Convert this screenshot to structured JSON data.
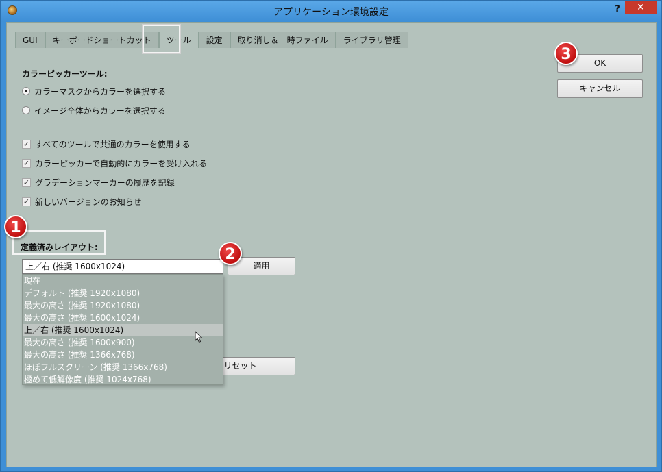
{
  "window": {
    "title": "アプリケーション環境設定",
    "help_label": "?",
    "close_label": "✕"
  },
  "tabs": [
    {
      "label": "GUI",
      "active": false
    },
    {
      "label": "キーボードショートカット",
      "active": false
    },
    {
      "label": "ツール",
      "active": true
    },
    {
      "label": "設定",
      "active": false
    },
    {
      "label": "取り消し＆一時ファイル",
      "active": false
    },
    {
      "label": "ライブラリ管理",
      "active": false
    }
  ],
  "color_picker": {
    "heading": "カラーピッカーツール:",
    "options": [
      {
        "label": "カラーマスクからカラーを選択する",
        "selected": true
      },
      {
        "label": "イメージ全体からカラーを選択する",
        "selected": false
      }
    ]
  },
  "checkboxes": [
    {
      "label": "すべてのツールで共通のカラーを使用する",
      "checked": true
    },
    {
      "label": "カラーピッカーで自動的にカラーを受け入れる",
      "checked": true
    },
    {
      "label": "グラデーションマーカーの履歴を記録",
      "checked": true
    },
    {
      "label": "新しいバージョンのお知らせ",
      "checked": true
    }
  ],
  "layout": {
    "heading": "定義済みレイアウト:",
    "selected_value": "上／右 (推奨 1600x1024)",
    "apply_label": "適用",
    "reset_label": "リセット",
    "options": [
      "現在",
      "デフォルト (推奨 1920x1080)",
      "最大の高さ (推奨 1920x1080)",
      "最大の高さ (推奨 1600x1024)",
      "上／右 (推奨 1600x1024)",
      "最大の高さ (推奨 1600x900)",
      "最大の高さ (推奨 1366x768)",
      "ほぼフルスクリーン (推奨 1366x768)",
      "極めて低解像度 (推奨 1024x768)"
    ],
    "highlighted_index": 4
  },
  "buttons": {
    "ok_label": "OK",
    "cancel_label": "キャンセル"
  },
  "badges": [
    "1",
    "2",
    "3"
  ]
}
